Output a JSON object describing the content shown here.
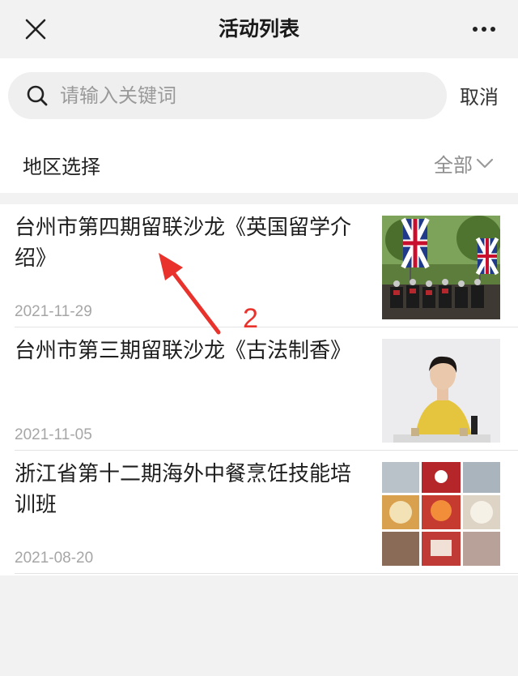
{
  "nav": {
    "title": "活动列表"
  },
  "search": {
    "placeholder": "请输入关键词",
    "cancel_label": "取消"
  },
  "region": {
    "label": "地区选择",
    "value": "全部"
  },
  "events": [
    {
      "title": "台州市第四期留联沙龙《英国留学介绍》",
      "date": "2021-11-29"
    },
    {
      "title": "台州市第三期留联沙龙《古法制香》",
      "date": "2021-11-05"
    },
    {
      "title": "浙江省第十二期海外中餐烹饪技能培训班",
      "date": "2021-08-20"
    }
  ],
  "annotation": {
    "number": "2",
    "color": "#e8322b"
  }
}
